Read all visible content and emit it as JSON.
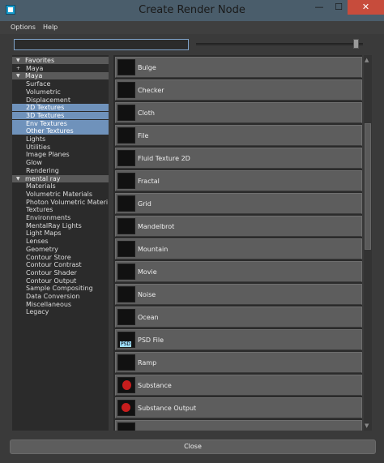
{
  "window": {
    "title": "Create Render Node",
    "controls": {
      "minimize": "—",
      "maximize": "☐",
      "close": "✕"
    }
  },
  "menubar": {
    "options": "Options",
    "help": "Help"
  },
  "search": {
    "value": "",
    "placeholder": ""
  },
  "slider": {
    "level": 0.94
  },
  "tree": {
    "rows": [
      {
        "label": "Favorites",
        "kind": "header",
        "arrow": "▼"
      },
      {
        "label": "Maya",
        "kind": "child-of-favorites",
        "arrow": "+"
      },
      {
        "label": "Maya",
        "kind": "header",
        "arrow": "▼"
      },
      {
        "label": "Surface",
        "kind": "item"
      },
      {
        "label": "Volumetric",
        "kind": "item"
      },
      {
        "label": "Displacement",
        "kind": "item"
      },
      {
        "label": "2D Textures",
        "kind": "selected"
      },
      {
        "label": "3D Textures",
        "kind": "selected"
      },
      {
        "label": "Env Textures",
        "kind": "selected"
      },
      {
        "label": "Other Textures",
        "kind": "selected"
      },
      {
        "label": "Lights",
        "kind": "item"
      },
      {
        "label": "Utilities",
        "kind": "item"
      },
      {
        "label": "Image Planes",
        "kind": "item"
      },
      {
        "label": "Glow",
        "kind": "item"
      },
      {
        "label": "Rendering",
        "kind": "item"
      },
      {
        "label": "mental ray",
        "kind": "header",
        "arrow": "▼"
      },
      {
        "label": "Materials",
        "kind": "item"
      },
      {
        "label": "Volumetric Materials",
        "kind": "item"
      },
      {
        "label": "Photon Volumetric Materi...",
        "kind": "item"
      },
      {
        "label": "Textures",
        "kind": "item"
      },
      {
        "label": "Environments",
        "kind": "item"
      },
      {
        "label": "MentalRay Lights",
        "kind": "item"
      },
      {
        "label": "Light Maps",
        "kind": "item"
      },
      {
        "label": "Lenses",
        "kind": "item"
      },
      {
        "label": "Geometry",
        "kind": "item"
      },
      {
        "label": "Contour Store",
        "kind": "item"
      },
      {
        "label": "Contour Contrast",
        "kind": "item"
      },
      {
        "label": "Contour Shader",
        "kind": "item"
      },
      {
        "label": "Contour Output",
        "kind": "item"
      },
      {
        "label": "Sample Compositing",
        "kind": "item"
      },
      {
        "label": "Data Conversion",
        "kind": "item"
      },
      {
        "label": "Miscellaneous",
        "kind": "item"
      },
      {
        "label": "Legacy",
        "kind": "item"
      }
    ]
  },
  "nodes": [
    {
      "label": "Bulge",
      "icon": "bulge-icon"
    },
    {
      "label": "Checker",
      "icon": "checker-icon"
    },
    {
      "label": "Cloth",
      "icon": "cloth-icon"
    },
    {
      "label": "File",
      "icon": "file-icon"
    },
    {
      "label": "Fluid Texture 2D",
      "icon": "fluid-texture-icon"
    },
    {
      "label": "Fractal",
      "icon": "fractal-icon"
    },
    {
      "label": "Grid",
      "icon": "grid-icon"
    },
    {
      "label": "Mandelbrot",
      "icon": "mandelbrot-icon"
    },
    {
      "label": "Mountain",
      "icon": "mountain-icon"
    },
    {
      "label": "Movie",
      "icon": "movie-icon"
    },
    {
      "label": "Noise",
      "icon": "noise-icon"
    },
    {
      "label": "Ocean",
      "icon": "ocean-icon"
    },
    {
      "label": "PSD File",
      "icon": "psd-file-icon"
    },
    {
      "label": "Ramp",
      "icon": "ramp-icon"
    },
    {
      "label": "Substance",
      "icon": "substance-icon"
    },
    {
      "label": "Substance Output",
      "icon": "substance-output-icon"
    }
  ],
  "footer": {
    "close_label": "Close"
  }
}
